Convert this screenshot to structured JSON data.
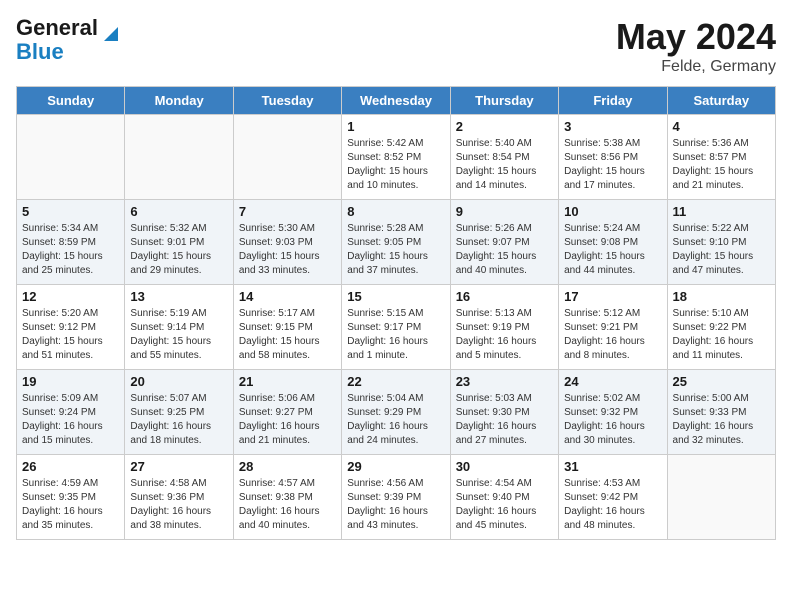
{
  "header": {
    "logo_line1": "General",
    "logo_line2": "Blue",
    "month_year": "May 2024",
    "location": "Felde, Germany"
  },
  "days_of_week": [
    "Sunday",
    "Monday",
    "Tuesday",
    "Wednesday",
    "Thursday",
    "Friday",
    "Saturday"
  ],
  "weeks": [
    [
      {
        "day": "",
        "info": ""
      },
      {
        "day": "",
        "info": ""
      },
      {
        "day": "",
        "info": ""
      },
      {
        "day": "1",
        "info": "Sunrise: 5:42 AM\nSunset: 8:52 PM\nDaylight: 15 hours\nand 10 minutes."
      },
      {
        "day": "2",
        "info": "Sunrise: 5:40 AM\nSunset: 8:54 PM\nDaylight: 15 hours\nand 14 minutes."
      },
      {
        "day": "3",
        "info": "Sunrise: 5:38 AM\nSunset: 8:56 PM\nDaylight: 15 hours\nand 17 minutes."
      },
      {
        "day": "4",
        "info": "Sunrise: 5:36 AM\nSunset: 8:57 PM\nDaylight: 15 hours\nand 21 minutes."
      }
    ],
    [
      {
        "day": "5",
        "info": "Sunrise: 5:34 AM\nSunset: 8:59 PM\nDaylight: 15 hours\nand 25 minutes."
      },
      {
        "day": "6",
        "info": "Sunrise: 5:32 AM\nSunset: 9:01 PM\nDaylight: 15 hours\nand 29 minutes."
      },
      {
        "day": "7",
        "info": "Sunrise: 5:30 AM\nSunset: 9:03 PM\nDaylight: 15 hours\nand 33 minutes."
      },
      {
        "day": "8",
        "info": "Sunrise: 5:28 AM\nSunset: 9:05 PM\nDaylight: 15 hours\nand 37 minutes."
      },
      {
        "day": "9",
        "info": "Sunrise: 5:26 AM\nSunset: 9:07 PM\nDaylight: 15 hours\nand 40 minutes."
      },
      {
        "day": "10",
        "info": "Sunrise: 5:24 AM\nSunset: 9:08 PM\nDaylight: 15 hours\nand 44 minutes."
      },
      {
        "day": "11",
        "info": "Sunrise: 5:22 AM\nSunset: 9:10 PM\nDaylight: 15 hours\nand 47 minutes."
      }
    ],
    [
      {
        "day": "12",
        "info": "Sunrise: 5:20 AM\nSunset: 9:12 PM\nDaylight: 15 hours\nand 51 minutes."
      },
      {
        "day": "13",
        "info": "Sunrise: 5:19 AM\nSunset: 9:14 PM\nDaylight: 15 hours\nand 55 minutes."
      },
      {
        "day": "14",
        "info": "Sunrise: 5:17 AM\nSunset: 9:15 PM\nDaylight: 15 hours\nand 58 minutes."
      },
      {
        "day": "15",
        "info": "Sunrise: 5:15 AM\nSunset: 9:17 PM\nDaylight: 16 hours\nand 1 minute."
      },
      {
        "day": "16",
        "info": "Sunrise: 5:13 AM\nSunset: 9:19 PM\nDaylight: 16 hours\nand 5 minutes."
      },
      {
        "day": "17",
        "info": "Sunrise: 5:12 AM\nSunset: 9:21 PM\nDaylight: 16 hours\nand 8 minutes."
      },
      {
        "day": "18",
        "info": "Sunrise: 5:10 AM\nSunset: 9:22 PM\nDaylight: 16 hours\nand 11 minutes."
      }
    ],
    [
      {
        "day": "19",
        "info": "Sunrise: 5:09 AM\nSunset: 9:24 PM\nDaylight: 16 hours\nand 15 minutes."
      },
      {
        "day": "20",
        "info": "Sunrise: 5:07 AM\nSunset: 9:25 PM\nDaylight: 16 hours\nand 18 minutes."
      },
      {
        "day": "21",
        "info": "Sunrise: 5:06 AM\nSunset: 9:27 PM\nDaylight: 16 hours\nand 21 minutes."
      },
      {
        "day": "22",
        "info": "Sunrise: 5:04 AM\nSunset: 9:29 PM\nDaylight: 16 hours\nand 24 minutes."
      },
      {
        "day": "23",
        "info": "Sunrise: 5:03 AM\nSunset: 9:30 PM\nDaylight: 16 hours\nand 27 minutes."
      },
      {
        "day": "24",
        "info": "Sunrise: 5:02 AM\nSunset: 9:32 PM\nDaylight: 16 hours\nand 30 minutes."
      },
      {
        "day": "25",
        "info": "Sunrise: 5:00 AM\nSunset: 9:33 PM\nDaylight: 16 hours\nand 32 minutes."
      }
    ],
    [
      {
        "day": "26",
        "info": "Sunrise: 4:59 AM\nSunset: 9:35 PM\nDaylight: 16 hours\nand 35 minutes."
      },
      {
        "day": "27",
        "info": "Sunrise: 4:58 AM\nSunset: 9:36 PM\nDaylight: 16 hours\nand 38 minutes."
      },
      {
        "day": "28",
        "info": "Sunrise: 4:57 AM\nSunset: 9:38 PM\nDaylight: 16 hours\nand 40 minutes."
      },
      {
        "day": "29",
        "info": "Sunrise: 4:56 AM\nSunset: 9:39 PM\nDaylight: 16 hours\nand 43 minutes."
      },
      {
        "day": "30",
        "info": "Sunrise: 4:54 AM\nSunset: 9:40 PM\nDaylight: 16 hours\nand 45 minutes."
      },
      {
        "day": "31",
        "info": "Sunrise: 4:53 AM\nSunset: 9:42 PM\nDaylight: 16 hours\nand 48 minutes."
      },
      {
        "day": "",
        "info": ""
      }
    ]
  ]
}
